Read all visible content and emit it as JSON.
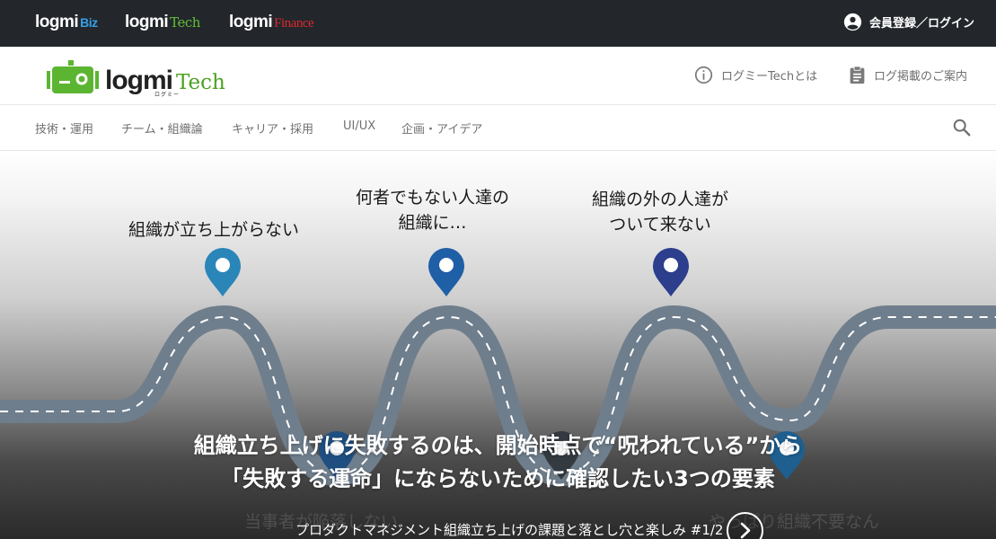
{
  "network": {
    "brands": [
      {
        "name": "logmi",
        "sub": "Biz",
        "sub_color": "#35a0e6"
      },
      {
        "name": "logmi",
        "sub": "Tech",
        "sub_color": "#62c036"
      },
      {
        "name": "logmi",
        "sub": "Finance",
        "sub_color": "#d92a2a"
      }
    ],
    "login_label": "会員登録／ログイン"
  },
  "header": {
    "logo_word": "logmi",
    "logo_tech": "Tech",
    "logo_kana": "ログミー",
    "about_label": "ログミーTechとは",
    "publish_label": "ログ掲載のご案内"
  },
  "nav": {
    "categories": [
      "技術・運用",
      "チーム・組織論",
      "キャリア・採用",
      "UI/UX",
      "企画・アイデア"
    ]
  },
  "hero": {
    "captions": [
      "組織が立ち上がらない",
      "何者でもない人達の\n組織に…",
      "組織の外の人達が\nついて来ない"
    ],
    "bottom_captions": [
      "当事者が陥落しない",
      "…やっぱり組織不要なん"
    ],
    "title_line1": "組織立ち上げに失敗するのは、開始時点で“呪われている”から",
    "title_line2": "「失敗する運命」にならないために確認したい3つの要素",
    "series": "プロダクトマネジメント組織立ち上げの課題と落とし穴と楽しみ #1/2",
    "pin_colors": [
      "#2a86b8",
      "#1f5fa6",
      "#2c3e8c"
    ],
    "road_color": "#6f7e8c",
    "accent_green": "#5cb531"
  }
}
